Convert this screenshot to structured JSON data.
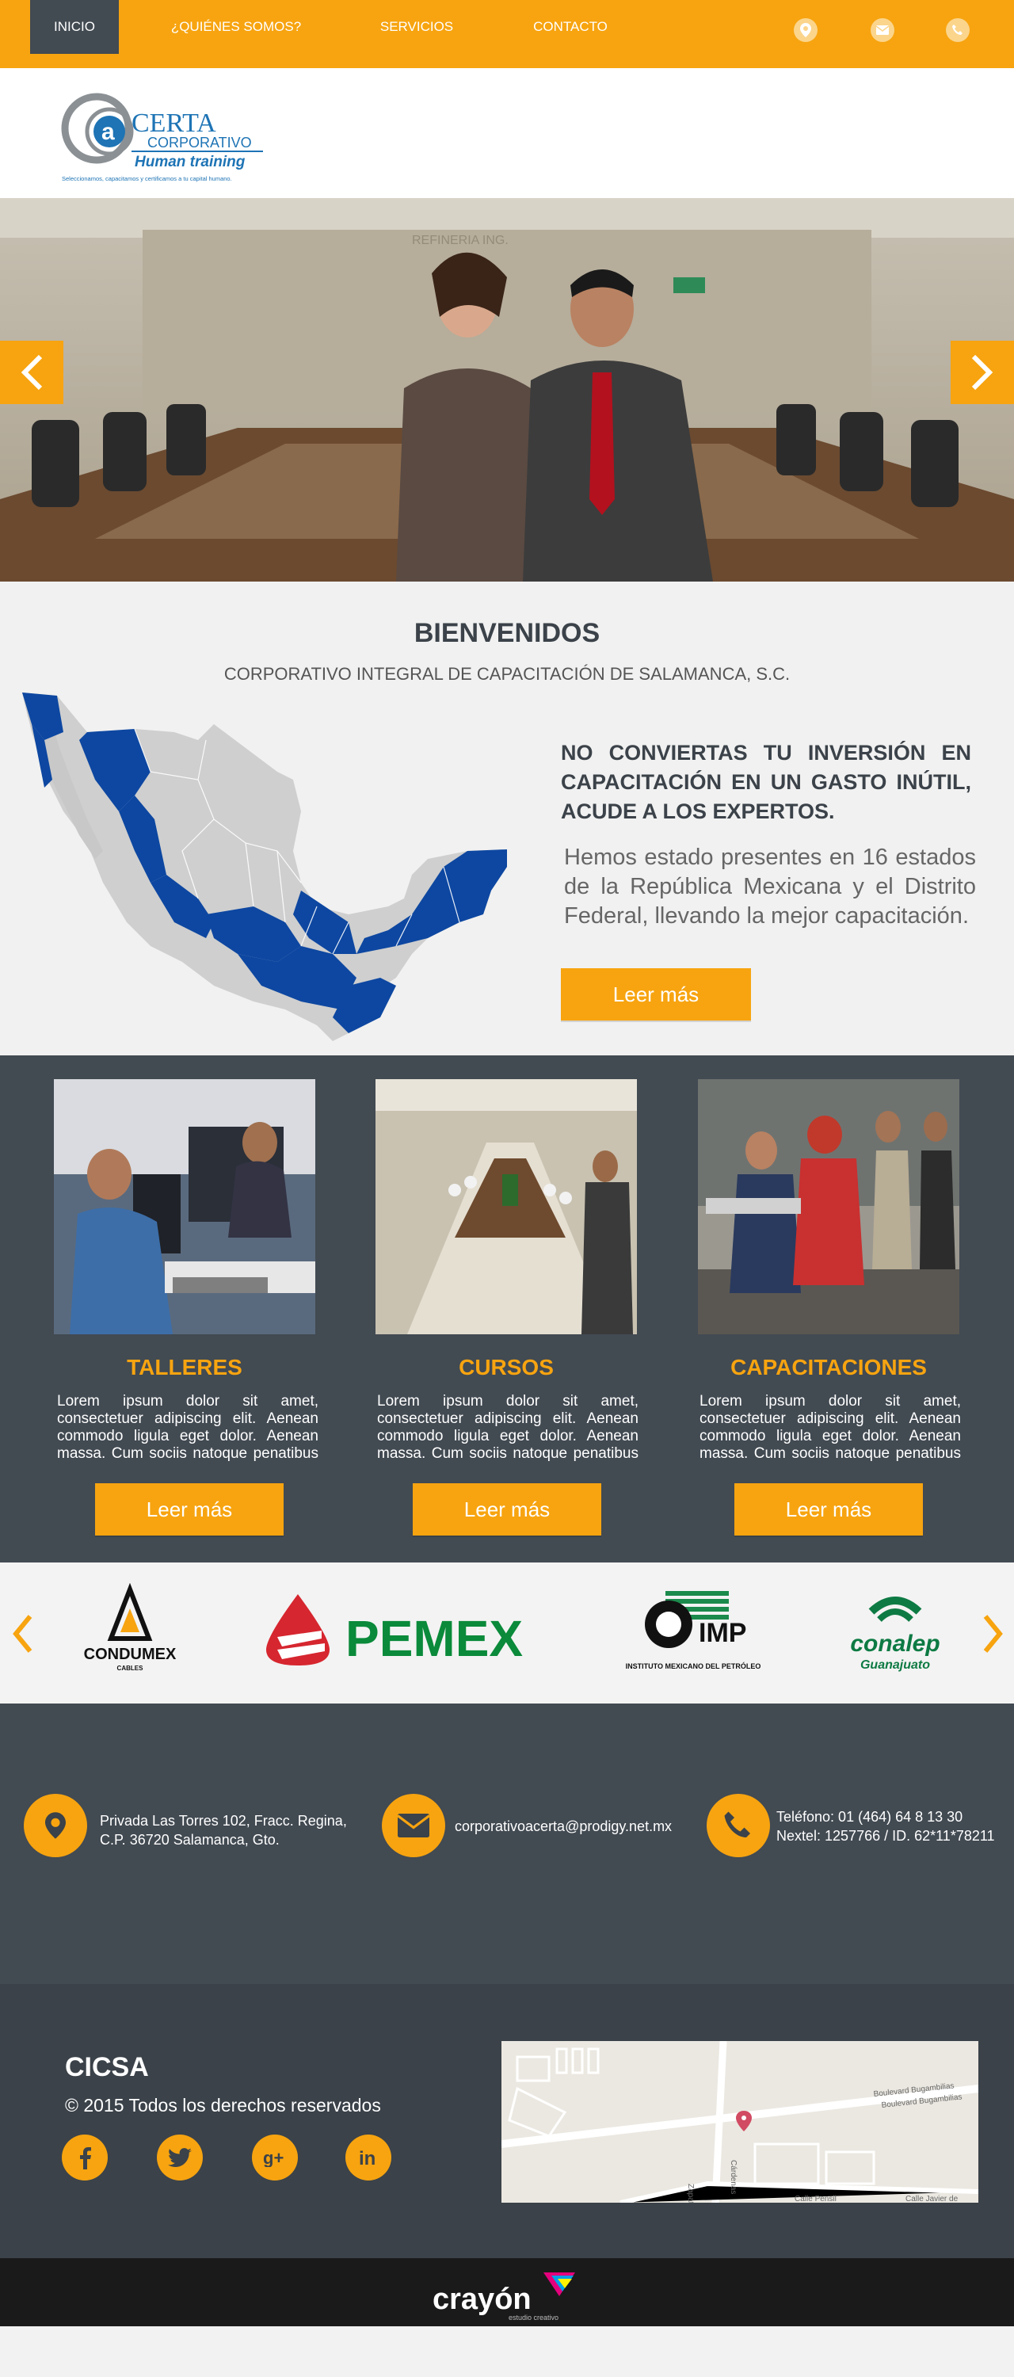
{
  "nav": {
    "items": [
      {
        "label": "INICIO"
      },
      {
        "label": "¿QUIÉNES SOMOS?"
      },
      {
        "label": "SERVICIOS"
      },
      {
        "label": "CONTACTO"
      }
    ],
    "icons": [
      "location-icon",
      "mail-icon",
      "phone-icon"
    ]
  },
  "logo": {
    "brand": "CERTA",
    "line2": "CORPORATIVO",
    "line3": "Human training",
    "tagline": "Seleccionamos, capacitamos y certificamos a tu capital humano."
  },
  "welcome": {
    "title": "BIENVENIDOS",
    "subtitle": "CORPORATIVO INTEGRAL DE CAPACITACIÓN DE SALAMANCA, S.C.",
    "headline": "NO CONVIERTAS TU INVERSIÓN EN CAPACITACIÓN EN UN GASTO INÚTIL, ACUDE A LOS EXPERTOS.",
    "body": "Hemos estado presentes en 16 estados de la República Mexicana y el Distrito Federal, llevando la mejor capacitación.",
    "button": "Leer más"
  },
  "services": [
    {
      "title": "TALLERES",
      "text": "Lorem ipsum dolor sit amet, consectetuer adipiscing elit. Aenean commodo ligula eget dolor. Aenean massa. Cum sociis natoque penatibus et",
      "button": "Leer más"
    },
    {
      "title": "CURSOS",
      "text": "Lorem ipsum dolor sit amet, consectetuer adipiscing elit. Aenean commodo ligula eget dolor. Aenean massa. Cum sociis natoque penatibus et",
      "button": "Leer más"
    },
    {
      "title": "CAPACITACIONES",
      "text": "Lorem ipsum dolor sit amet, consectetuer adipiscing elit. Aenean commodo ligula eget dolor. Aenean massa. Cum sociis natoque penatibus et",
      "button": "Leer más"
    }
  ],
  "clients": [
    {
      "name": "CONDUMEX",
      "sub": "CABLES"
    },
    {
      "name": "PEMEX"
    },
    {
      "name": "IMP",
      "sub": "INSTITUTO MEXICANO DEL PETRÓLEO"
    },
    {
      "name": "conalep",
      "sub": "Guanajuato"
    }
  ],
  "contact": {
    "address": "Privada Las Torres 102, Fracc. Regina, C.P. 36720 Salamanca, Gto.",
    "email": "corporativoacerta@prodigy.net.mx",
    "phone": "Teléfono: 01 (464) 64 8 13 30",
    "nextel": "Nextel: 1257766  / ID. 62*11*78211"
  },
  "footer": {
    "title": "CICSA",
    "copyright": "© 2015 Todos los derechos reservados",
    "social": [
      "facebook-icon",
      "twitter-icon",
      "google-plus-icon",
      "linkedin-icon"
    ],
    "map": {
      "street1": "Boulevard Bugambilias",
      "street2": "Calle Pensil",
      "street3": "Calle Javier de",
      "street4": "Cárdenas",
      "street5": "Zapata"
    }
  },
  "brand": {
    "name": "crayón",
    "sub": "estudio creativo"
  },
  "colors": {
    "accent": "#f7a410",
    "dark": "#424a52",
    "footer": "#3b4249",
    "map_blue": "#0d47a1"
  }
}
